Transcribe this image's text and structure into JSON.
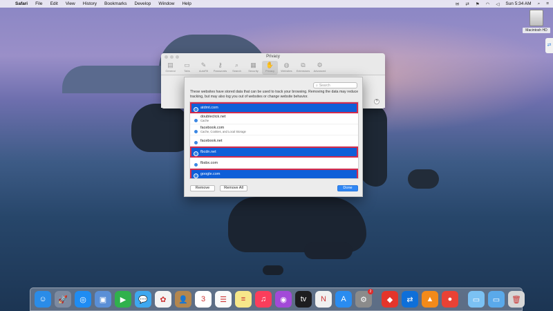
{
  "menubar": {
    "apple": "",
    "app": "Safari",
    "items": [
      "File",
      "Edit",
      "View",
      "History",
      "Bookmarks",
      "Develop",
      "Window",
      "Help"
    ],
    "clock": "Sun 5:34 AM"
  },
  "desktop": {
    "drive_label": "Macintosh HD"
  },
  "prefs_window": {
    "title": "Privacy",
    "tabs": [
      {
        "label": "General",
        "icon": "general-icon",
        "glyph": "▤"
      },
      {
        "label": "Tabs",
        "icon": "tabs-icon",
        "glyph": "▭"
      },
      {
        "label": "AutoFill",
        "icon": "autofill-icon",
        "glyph": "✎"
      },
      {
        "label": "Passwords",
        "icon": "key-icon",
        "glyph": "⚷"
      },
      {
        "label": "Search",
        "icon": "search-icon",
        "glyph": "⌕"
      },
      {
        "label": "Security",
        "icon": "lock-icon",
        "glyph": "▦"
      },
      {
        "label": "Privacy",
        "icon": "privacy-icon",
        "glyph": "✋"
      },
      {
        "label": "Websites",
        "icon": "globe-icon",
        "glyph": "◍"
      },
      {
        "label": "Extensions",
        "icon": "puzzle-icon",
        "glyph": "⧉"
      },
      {
        "label": "Advanced",
        "icon": "gear-icon",
        "glyph": "⚙"
      }
    ],
    "active_tab": "Privacy",
    "help": "?"
  },
  "website_data": {
    "search_placeholder": "Search",
    "description": "These websites have stored data that can be used to track your browsing. Removing the data may reduce tracking, but may also log you out of websites or change website behavior.",
    "rows": [
      {
        "site": "atdmt.com",
        "detail": "",
        "selected": true
      },
      {
        "site": "doubleclick.net",
        "detail": "Cache",
        "selected": false
      },
      {
        "site": "facebook.com",
        "detail": "Cache, Cookies, and Local Storage",
        "selected": false
      },
      {
        "site": "facebook.net",
        "detail": "",
        "selected": false
      },
      {
        "site": "fbcdn.net",
        "detail": "",
        "selected": true
      },
      {
        "site": "fbsbx.com",
        "detail": "",
        "selected": false
      },
      {
        "site": "google.com",
        "detail": "",
        "selected": true
      }
    ],
    "buttons": {
      "remove": "Remove",
      "remove_all": "Remove All",
      "done": "Done"
    }
  },
  "dock": {
    "apps": [
      {
        "name": "finder-icon",
        "color": "#2a8ce8",
        "glyph": "☺"
      },
      {
        "name": "launchpad-icon",
        "color": "#7d8ba1",
        "glyph": "🚀"
      },
      {
        "name": "safari-icon",
        "color": "#1f8cf2",
        "glyph": "◎"
      },
      {
        "name": "photo-preview-icon",
        "color": "#5a8fd6",
        "glyph": "▣"
      },
      {
        "name": "facetime-icon",
        "color": "#30b14c",
        "glyph": "▶"
      },
      {
        "name": "messages-icon",
        "color": "#3ea8f0",
        "glyph": "💬"
      },
      {
        "name": "photos-icon",
        "color": "#f3f3f3",
        "glyph": "✿"
      },
      {
        "name": "contacts-icon",
        "color": "#b4874e",
        "glyph": "👤"
      },
      {
        "name": "calendar-icon",
        "color": "#ffffff",
        "glyph": "3"
      },
      {
        "name": "reminders-icon",
        "color": "#fafafa",
        "glyph": "☰"
      },
      {
        "name": "notes-icon",
        "color": "#f7e78a",
        "glyph": "≡"
      },
      {
        "name": "music-icon",
        "color": "#fb3d5b",
        "glyph": "♫"
      },
      {
        "name": "podcasts-icon",
        "color": "#a24ad8",
        "glyph": "◉"
      },
      {
        "name": "tv-icon",
        "color": "#1d1d1f",
        "glyph": "tv"
      },
      {
        "name": "news-icon",
        "color": "#f0f0f0",
        "glyph": "N"
      },
      {
        "name": "app-store-icon",
        "color": "#2a8cf0",
        "glyph": "A"
      },
      {
        "name": "system-preferences-icon",
        "color": "#8b8b8b",
        "glyph": "⚙",
        "badge": "2"
      },
      {
        "name": "anydesk-icon",
        "color": "#e3352b",
        "glyph": "◆"
      },
      {
        "name": "teamviewer-icon",
        "color": "#0e6fd9",
        "glyph": "⇄"
      },
      {
        "name": "vlc-icon",
        "color": "#f28a1a",
        "glyph": "▲"
      },
      {
        "name": "chrome-icon",
        "color": "#e94235",
        "glyph": "●"
      },
      {
        "name": "folder-icon",
        "color": "#7bc1f3",
        "glyph": "▭"
      },
      {
        "name": "downloads-folder-icon",
        "color": "#5aa9ea",
        "glyph": "▭"
      },
      {
        "name": "trash-icon",
        "color": "#d7d7d7",
        "glyph": "🗑"
      }
    ]
  }
}
